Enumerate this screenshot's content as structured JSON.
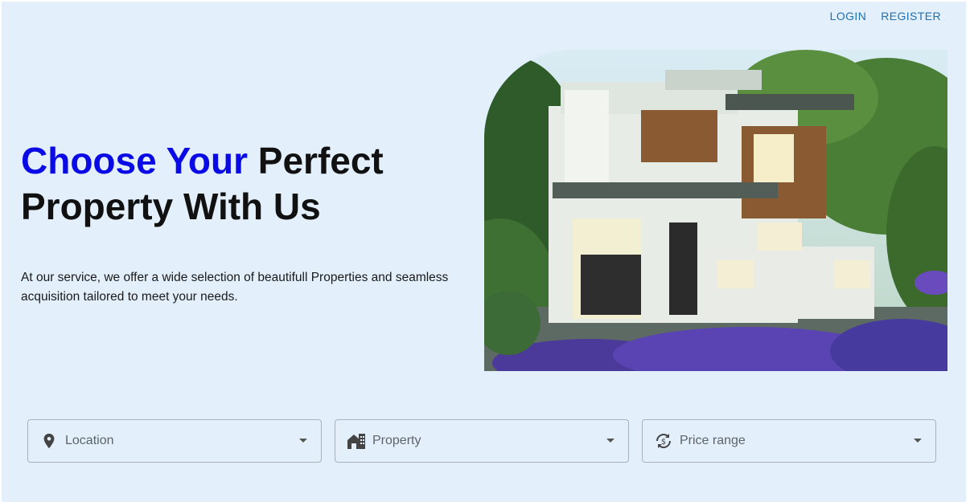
{
  "nav": {
    "login": "LOGIN",
    "register": "REGISTER"
  },
  "hero": {
    "title_accent": "Choose Your",
    "title_rest": "Perfect Property With Us",
    "description": "At our service, we offer a wide selection of beautifull Properties and seamless acquisition tailored to meet your needs."
  },
  "filters": [
    {
      "label": "Location",
      "icon": "location-pin-icon"
    },
    {
      "label": "Property",
      "icon": "house-building-icon"
    },
    {
      "label": "Price range",
      "icon": "currency-exchange-icon"
    }
  ],
  "colors": {
    "accent": "#0a0ae6",
    "link": "#1f6fb2",
    "background": "#e3f0fc"
  }
}
